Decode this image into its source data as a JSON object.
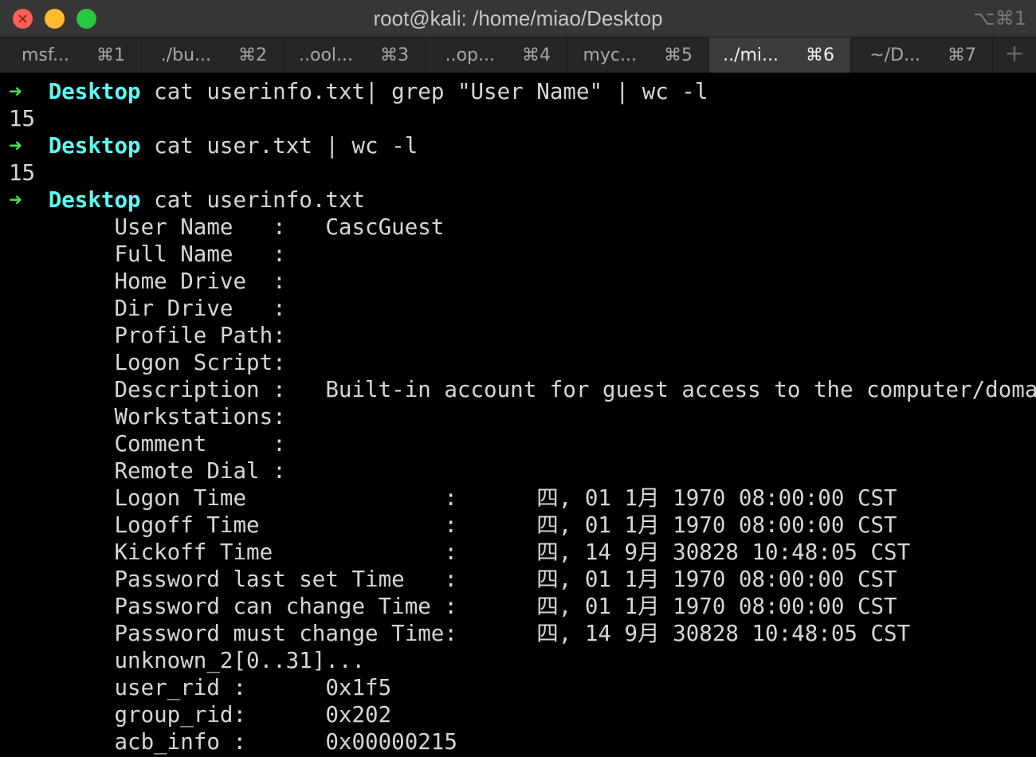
{
  "window": {
    "title": "root@kali: /home/miao/Desktop",
    "shortcut": "⌥⌘1"
  },
  "tabs": [
    {
      "label": "msf...",
      "key": "⌘1",
      "active": false
    },
    {
      "label": "./bu...",
      "key": "⌘2",
      "active": false
    },
    {
      "label": "..ool...",
      "key": "⌘3",
      "active": false
    },
    {
      "label": "..op...",
      "key": "⌘4",
      "active": false
    },
    {
      "label": "myc...",
      "key": "⌘5",
      "active": false
    },
    {
      "label": "../mi...",
      "key": "⌘6",
      "active": true
    },
    {
      "label": "~/D...",
      "key": "⌘7",
      "active": false
    }
  ],
  "new_tab_label": "+",
  "terminal": {
    "lines": [
      {
        "type": "prompt",
        "arrow": "➜",
        "dir": "Desktop",
        "cmd": " cat userinfo.txt| grep \"User Name\" | wc -l"
      },
      {
        "type": "output",
        "text": "15"
      },
      {
        "type": "prompt",
        "arrow": "➜",
        "dir": "Desktop",
        "cmd": " cat user.txt | wc -l"
      },
      {
        "type": "output",
        "text": "15"
      },
      {
        "type": "prompt",
        "arrow": "➜",
        "dir": "Desktop",
        "cmd": " cat userinfo.txt"
      },
      {
        "type": "output",
        "text": "        User Name   :   CascGuest"
      },
      {
        "type": "output",
        "text": "        Full Name   :"
      },
      {
        "type": "output",
        "text": "        Home Drive  :"
      },
      {
        "type": "output",
        "text": "        Dir Drive   :"
      },
      {
        "type": "output",
        "text": "        Profile Path:"
      },
      {
        "type": "output",
        "text": "        Logon Script:"
      },
      {
        "type": "output",
        "text": "        Description :   Built-in account for guest access to the computer/domain"
      },
      {
        "type": "output",
        "text": "        Workstations:"
      },
      {
        "type": "output",
        "text": "        Comment     :"
      },
      {
        "type": "output",
        "text": "        Remote Dial :"
      },
      {
        "type": "output",
        "text": "        Logon Time               :      四, 01 1月 1970 08:00:00 CST"
      },
      {
        "type": "output",
        "text": "        Logoff Time              :      四, 01 1月 1970 08:00:00 CST"
      },
      {
        "type": "output",
        "text": "        Kickoff Time             :      四, 14 9月 30828 10:48:05 CST"
      },
      {
        "type": "output",
        "text": "        Password last set Time   :      四, 01 1月 1970 08:00:00 CST"
      },
      {
        "type": "output",
        "text": "        Password can change Time :      四, 01 1月 1970 08:00:00 CST"
      },
      {
        "type": "output",
        "text": "        Password must change Time:      四, 14 9月 30828 10:48:05 CST"
      },
      {
        "type": "output",
        "text": "        unknown_2[0..31]..."
      },
      {
        "type": "output",
        "text": "        user_rid :      0x1f5"
      },
      {
        "type": "output",
        "text": "        group_rid:      0x202"
      },
      {
        "type": "output",
        "text": "        acb_info :      0x00000215"
      }
    ]
  },
  "colors": {
    "prompt_arrow": "#44e05b",
    "prompt_dir": "#5dfbf3",
    "text": "#d6d6d6",
    "background": "#000000"
  }
}
